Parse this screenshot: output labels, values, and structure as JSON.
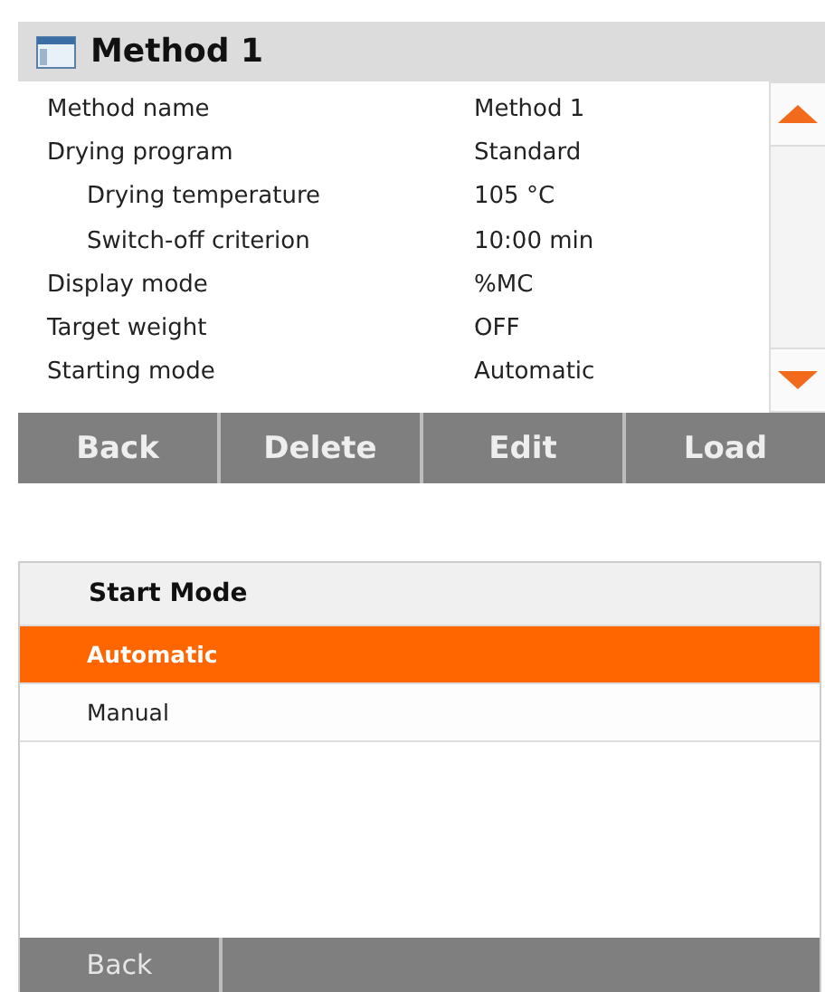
{
  "method_screen": {
    "title": "Method 1",
    "rows": [
      {
        "label": "Method name",
        "value": "Method 1",
        "children": []
      },
      {
        "label": "Drying program",
        "value": "Standard",
        "children": [
          {
            "label": "Drying temperature",
            "value": "105 °C"
          },
          {
            "label": "Switch-off criterion",
            "value": "10:00 min"
          }
        ]
      },
      {
        "label": "Display mode",
        "value": "%MC",
        "children": []
      },
      {
        "label": "Target weight",
        "value": "OFF",
        "children": []
      },
      {
        "label": "Starting mode",
        "value": "Automatic",
        "children": []
      }
    ],
    "buttons": [
      "Back",
      "Delete",
      "Edit",
      "Load"
    ]
  },
  "start_mode_screen": {
    "title": "Start Mode",
    "options": [
      {
        "label": "Automatic",
        "selected": true
      },
      {
        "label": "Manual",
        "selected": false
      }
    ],
    "buttons": [
      "Back"
    ]
  }
}
